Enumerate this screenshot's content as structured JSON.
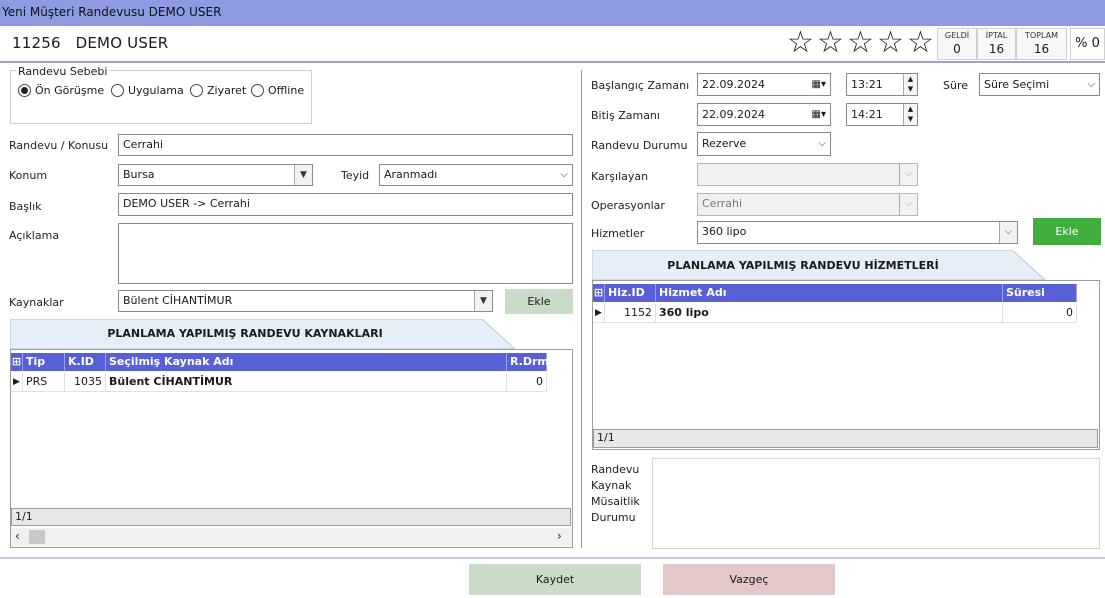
{
  "window": {
    "title": "Yeni Müşteri Randevusu DEMO USER"
  },
  "header": {
    "customer_id": "11256",
    "customer_name": "DEMO USER",
    "rating_stars": 0,
    "stats": [
      {
        "label": "GELDİ",
        "value": "0"
      },
      {
        "label": "İPTAL",
        "value": "16"
      },
      {
        "label": "TOPLAM",
        "value": "16"
      }
    ],
    "percent": "% 0"
  },
  "reason": {
    "group_title": "Randevu Sebebi",
    "options": [
      "Ön Görüşme",
      "Uygulama",
      "Ziyaret",
      "Offline"
    ],
    "selected": "Ön Görüşme"
  },
  "left_form": {
    "subject_label": "Randevu / Konusu",
    "subject_value": "Cerrahi",
    "location_label": "Konum",
    "location_value": "Bursa",
    "confirm_label": "Teyid",
    "confirm_value": "Aranmadı",
    "heading_label": "Başlık",
    "heading_value": "DEMO USER -> Cerrahi",
    "description_label": "Açıklama",
    "description_value": "",
    "resources_label": "Kaynaklar",
    "resources_value": "Bülent CİHANTİMUR",
    "add_label": "Ekle"
  },
  "resources_table": {
    "title": "PLANLAMA YAPILMIŞ RANDEVU KAYNAKLARI",
    "columns": [
      "Tip",
      "K.ID",
      "Seçilmiş Kaynak Adı",
      "R.Drm"
    ],
    "rows": [
      {
        "tip": "PRS",
        "kid": "1035",
        "name": "Bülent CİHANTİMUR",
        "rdrm": "0"
      }
    ],
    "footer": "1/1"
  },
  "right_form": {
    "start_label": "Başlangıç Zamanı",
    "start_date": "22.09.2024",
    "start_time": "13:21",
    "end_label": "Bitiş Zamanı",
    "end_date": "22.09.2024",
    "end_time": "14:21",
    "duration_label": "Süre",
    "duration_value": "Süre Seçimi",
    "status_label": "Randevu Durumu",
    "status_value": "Rezerve",
    "greeter_label": "Karşılayan",
    "greeter_value": "",
    "operations_label": "Operasyonlar",
    "operations_value": "Cerrahi",
    "services_label": "Hizmetler",
    "services_value": "360 lipo",
    "add_label": "Ekle"
  },
  "services_table": {
    "title": "PLANLAMA YAPILMIŞ RANDEVU HİZMETLERİ",
    "columns": [
      "Hiz.ID",
      "Hizmet Adı",
      "Süresi"
    ],
    "rows": [
      {
        "id": "1152",
        "name": "360 lipo",
        "duration": "0"
      }
    ],
    "footer": "1/1"
  },
  "availability": {
    "label_lines": [
      "Randevu",
      "Kaynak",
      "Müsaitlik",
      "Durumu"
    ]
  },
  "footer": {
    "save_label": "Kaydet",
    "cancel_label": "Vazgeç"
  },
  "colors": {
    "titlebar": "#8e9be0",
    "grid_header": "#5860d8",
    "add_green": "#3fae3f",
    "save": "#c8dcc8",
    "cancel": "#e2c8c8"
  }
}
